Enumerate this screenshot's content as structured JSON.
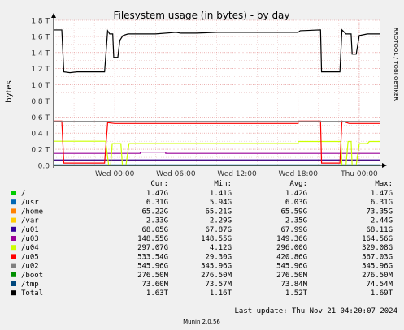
{
  "chart_data": {
    "type": "line",
    "title": "Filesystem usage (in bytes) - by day",
    "ylabel": "bytes",
    "side_label": "RRDTOOL / TOBI OETIKER",
    "footer": "Munin 2.0.56",
    "last_update": "Last update: Thu Nov 21 04:20:07 2024",
    "ylim": [
      0,
      1.8
    ],
    "y_ticks": [
      {
        "v": 0.0,
        "label": "0.0"
      },
      {
        "v": 0.2,
        "label": "0.2 T"
      },
      {
        "v": 0.4,
        "label": "0.4 T"
      },
      {
        "v": 0.6,
        "label": "0.6 T"
      },
      {
        "v": 0.8,
        "label": "0.8 T"
      },
      {
        "v": 1.0,
        "label": "1.0 T"
      },
      {
        "v": 1.2,
        "label": "1.2 T"
      },
      {
        "v": 1.4,
        "label": "1.4 T"
      },
      {
        "v": 1.6,
        "label": "1.6 T"
      },
      {
        "v": 1.8,
        "label": "1.8 T"
      }
    ],
    "xlim": [
      0,
      32
    ],
    "x_ticks": [
      {
        "h": 6,
        "label": "Wed 00:00"
      },
      {
        "h": 12,
        "label": "Wed 06:00"
      },
      {
        "h": 18,
        "label": "Wed 12:00"
      },
      {
        "h": 24,
        "label": "Wed 18:00"
      },
      {
        "h": 30,
        "label": "Thu 00:00"
      }
    ],
    "columns": [
      "Cur:",
      "Min:",
      "Avg:",
      "Max:"
    ],
    "series": [
      {
        "name": "/",
        "color": "#00cc00",
        "cur": "1.47G",
        "min": "1.41G",
        "avg": "1.42G",
        "max": "1.47G",
        "points": [
          [
            0,
            0.0014
          ]
        ]
      },
      {
        "name": "/usr",
        "color": "#0066b3",
        "cur": "6.31G",
        "min": "5.94G",
        "avg": "6.03G",
        "max": "6.31G",
        "points": [
          [
            0,
            0.006
          ]
        ]
      },
      {
        "name": "/home",
        "color": "#ff8000",
        "cur": "65.22G",
        "min": "65.21G",
        "avg": "65.59G",
        "max": "73.35G",
        "points": [
          [
            0,
            0.065
          ]
        ]
      },
      {
        "name": "/var",
        "color": "#ffcc00",
        "cur": "2.33G",
        "min": "2.29G",
        "avg": "2.35G",
        "max": "2.44G",
        "points": [
          [
            0,
            0.0023
          ]
        ]
      },
      {
        "name": "/u01",
        "color": "#330099",
        "cur": "68.05G",
        "min": "67.87G",
        "avg": "67.99G",
        "max": "68.11G",
        "points": [
          [
            0,
            0.068
          ]
        ]
      },
      {
        "name": "/u03",
        "color": "#990099",
        "cur": "148.55G",
        "min": "148.55G",
        "avg": "149.36G",
        "max": "164.56G",
        "points": [
          [
            0,
            0.149
          ],
          [
            8.5,
            0.149
          ],
          [
            8.5,
            0.165
          ],
          [
            11,
            0.165
          ],
          [
            11,
            0.149
          ],
          [
            32,
            0.149
          ]
        ]
      },
      {
        "name": "/u04",
        "color": "#ccff00",
        "cur": "297.07G",
        "min": "4.12G",
        "avg": "296.00G",
        "max": "329.08G",
        "points": [
          [
            0,
            0.3
          ],
          [
            5.1,
            0.3
          ],
          [
            5.4,
            0.004
          ],
          [
            5.6,
            0.004
          ],
          [
            5.75,
            0.27
          ],
          [
            6.6,
            0.27
          ],
          [
            6.75,
            0.004
          ],
          [
            7.1,
            0.004
          ],
          [
            7.4,
            0.27
          ],
          [
            24,
            0.27
          ],
          [
            24,
            0.297
          ],
          [
            28.2,
            0.297
          ],
          [
            28.3,
            0.004
          ],
          [
            28.7,
            0.004
          ],
          [
            28.9,
            0.297
          ],
          [
            29.2,
            0.297
          ],
          [
            29.3,
            0.004
          ],
          [
            29.7,
            0.004
          ],
          [
            30,
            0.27
          ],
          [
            30.8,
            0.27
          ],
          [
            31,
            0.297
          ],
          [
            32,
            0.297
          ]
        ]
      },
      {
        "name": "/u05",
        "color": "#ff0000",
        "cur": "533.54G",
        "min": "29.30G",
        "avg": "420.86G",
        "max": "567.03G",
        "points": [
          [
            0,
            0.55
          ],
          [
            0.8,
            0.55
          ],
          [
            1,
            0.029
          ],
          [
            5,
            0.029
          ],
          [
            5.3,
            0.53
          ],
          [
            6,
            0.52
          ],
          [
            16.1,
            0.52
          ],
          [
            24,
            0.52
          ],
          [
            24,
            0.55
          ],
          [
            26.2,
            0.55
          ],
          [
            26.3,
            0.029
          ],
          [
            28.1,
            0.029
          ],
          [
            28.3,
            0.55
          ],
          [
            29,
            0.52
          ],
          [
            32,
            0.52
          ]
        ]
      },
      {
        "name": "/u02",
        "color": "#808080",
        "cur": "545.96G",
        "min": "545.96G",
        "avg": "545.96G",
        "max": "545.96G",
        "points": [
          [
            0,
            0.546
          ],
          [
            32,
            0.546
          ]
        ]
      },
      {
        "name": "/boot",
        "color": "#008f00",
        "cur": "276.50M",
        "min": "276.50M",
        "avg": "276.50M",
        "max": "276.50M",
        "points": [
          [
            0,
            0.0003
          ],
          [
            32,
            0.0003
          ]
        ]
      },
      {
        "name": "/tmp",
        "color": "#00487d",
        "cur": "73.60M",
        "min": "73.57M",
        "avg": "73.84M",
        "max": "74.54M",
        "points": [
          [
            0,
            0.0001
          ],
          [
            32,
            0.0001
          ]
        ]
      },
      {
        "name": "Total",
        "color": "#000000",
        "cur": "1.63T",
        "min": "1.16T",
        "avg": "1.52T",
        "max": "1.69T",
        "points": [
          [
            0,
            1.68
          ],
          [
            0.8,
            1.68
          ],
          [
            1,
            1.16
          ],
          [
            1.6,
            1.15
          ],
          [
            2.3,
            1.16
          ],
          [
            5,
            1.16
          ],
          [
            5.3,
            1.67
          ],
          [
            5.5,
            1.63
          ],
          [
            5.8,
            1.63
          ],
          [
            5.9,
            1.34
          ],
          [
            6.3,
            1.34
          ],
          [
            6.5,
            1.55
          ],
          [
            6.8,
            1.61
          ],
          [
            7.3,
            1.63
          ],
          [
            10,
            1.63
          ],
          [
            12,
            1.65
          ],
          [
            12.5,
            1.64
          ],
          [
            14,
            1.64
          ],
          [
            16,
            1.65
          ],
          [
            24,
            1.65
          ],
          [
            24.2,
            1.67
          ],
          [
            26.2,
            1.68
          ],
          [
            26.3,
            1.16
          ],
          [
            28.1,
            1.16
          ],
          [
            28.3,
            1.68
          ],
          [
            28.7,
            1.63
          ],
          [
            29.2,
            1.63
          ],
          [
            29.3,
            1.38
          ],
          [
            29.7,
            1.38
          ],
          [
            30,
            1.61
          ],
          [
            30.8,
            1.63
          ],
          [
            32,
            1.63
          ]
        ]
      }
    ]
  }
}
